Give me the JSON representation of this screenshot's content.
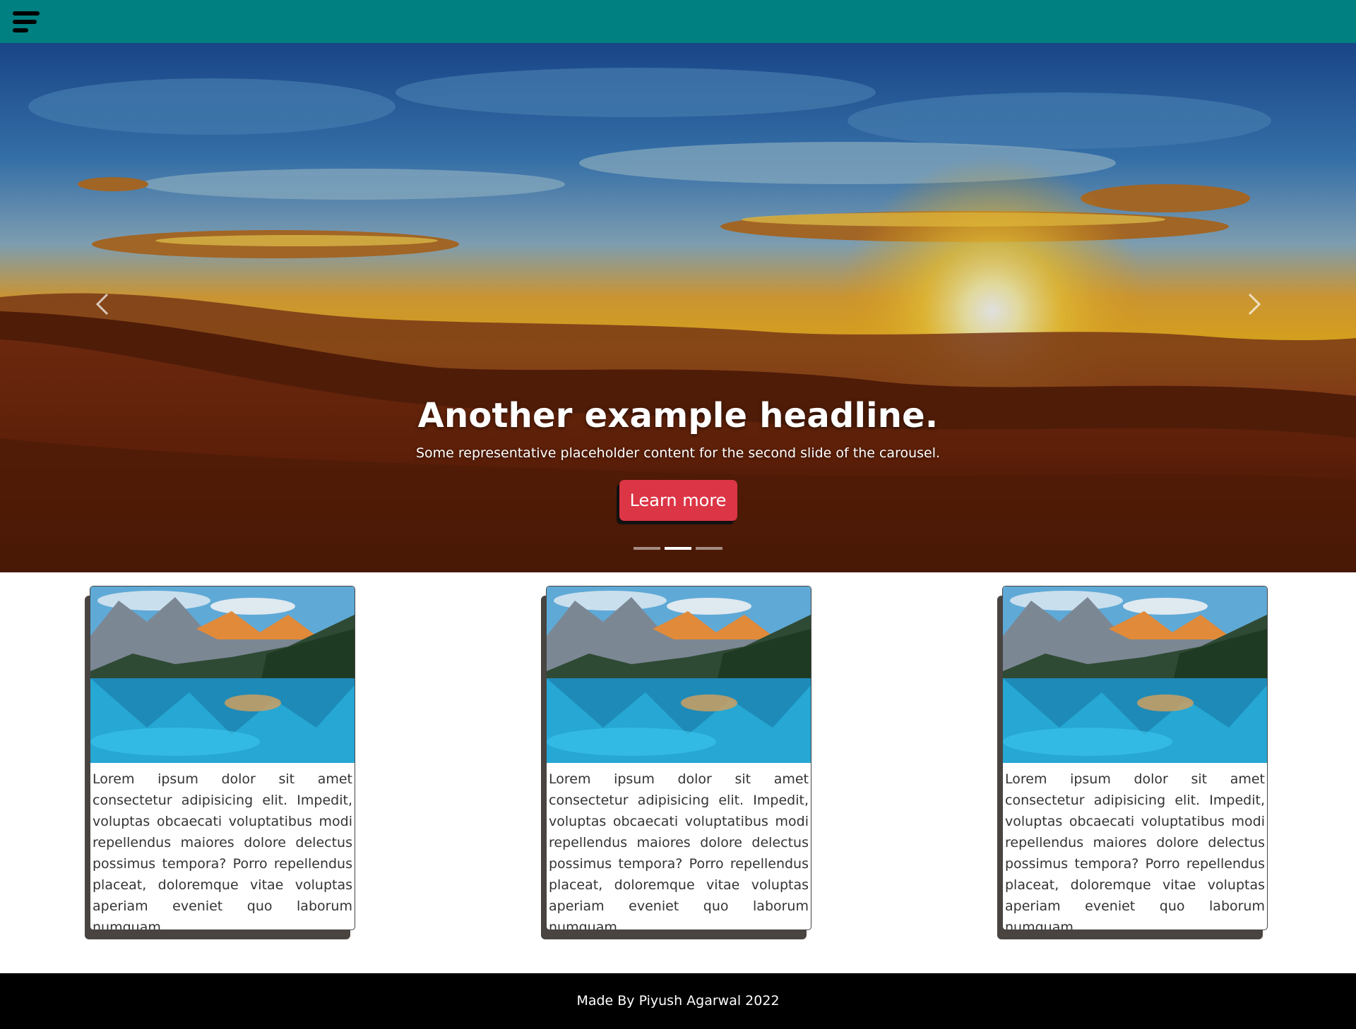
{
  "nav": {
    "menu_icon": "hamburger-menu-icon",
    "bar_color": "#008080"
  },
  "carousel": {
    "headline": "Another example headline.",
    "text": "Some representative placeholder content for the second slide of the carousel.",
    "button_label": "Learn more",
    "button_color": "#dc3545",
    "prev_icon": "chevron-left-icon",
    "next_icon": "chevron-right-icon",
    "slide_count": 3,
    "active_slide": 2
  },
  "cards": [
    {
      "image": "mountain-lake-image",
      "text": "Lorem ipsum dolor sit amet consectetur adipisicing elit. Impedit, voluptas obcaecati voluptatibus modi repellendus maiores dolore delectus possimus tempora? Porro repellendus placeat, doloremque vitae voluptas aperiam eveniet quo laborum numquam."
    },
    {
      "image": "mountain-lake-image",
      "text": "Lorem ipsum dolor sit amet consectetur adipisicing elit. Impedit, voluptas obcaecati voluptatibus modi repellendus maiores dolore delectus possimus tempora? Porro repellendus placeat, doloremque vitae voluptas aperiam eveniet quo laborum numquam."
    },
    {
      "image": "mountain-lake-image",
      "text": "Lorem ipsum dolor sit amet consectetur adipisicing elit. Impedit, voluptas obcaecati voluptatibus modi repellendus maiores dolore delectus possimus tempora? Porro repellendus placeat, doloremque vitae voluptas aperiam eveniet quo laborum numquam."
    }
  ],
  "footer": {
    "text": "Made By Piyush Agarwal 2022"
  }
}
